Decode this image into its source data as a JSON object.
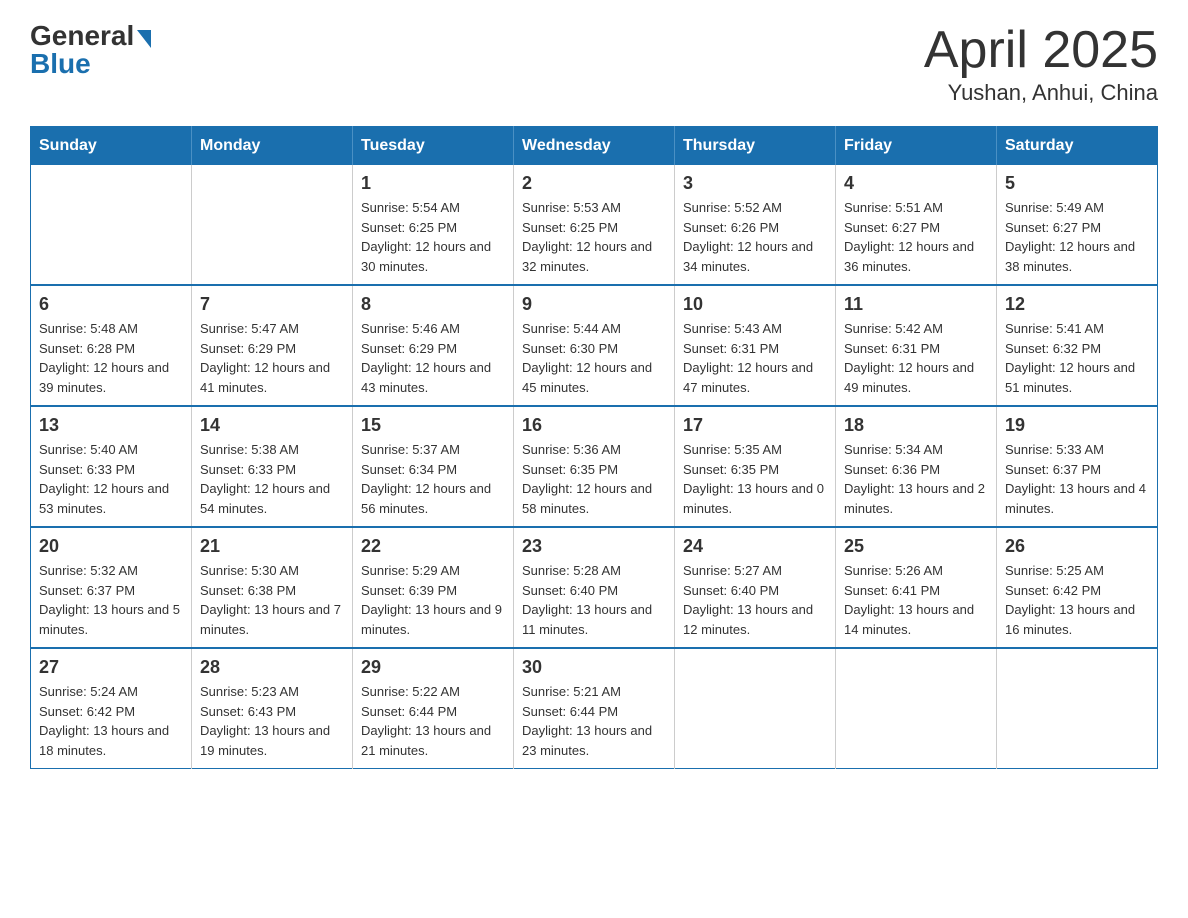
{
  "header": {
    "logo_general": "General",
    "logo_blue": "Blue",
    "title": "April 2025",
    "subtitle": "Yushan, Anhui, China"
  },
  "calendar": {
    "weekdays": [
      "Sunday",
      "Monday",
      "Tuesday",
      "Wednesday",
      "Thursday",
      "Friday",
      "Saturday"
    ],
    "weeks": [
      [
        {
          "day": "",
          "sunrise": "",
          "sunset": "",
          "daylight": ""
        },
        {
          "day": "",
          "sunrise": "",
          "sunset": "",
          "daylight": ""
        },
        {
          "day": "1",
          "sunrise": "Sunrise: 5:54 AM",
          "sunset": "Sunset: 6:25 PM",
          "daylight": "Daylight: 12 hours and 30 minutes."
        },
        {
          "day": "2",
          "sunrise": "Sunrise: 5:53 AM",
          "sunset": "Sunset: 6:25 PM",
          "daylight": "Daylight: 12 hours and 32 minutes."
        },
        {
          "day": "3",
          "sunrise": "Sunrise: 5:52 AM",
          "sunset": "Sunset: 6:26 PM",
          "daylight": "Daylight: 12 hours and 34 minutes."
        },
        {
          "day": "4",
          "sunrise": "Sunrise: 5:51 AM",
          "sunset": "Sunset: 6:27 PM",
          "daylight": "Daylight: 12 hours and 36 minutes."
        },
        {
          "day": "5",
          "sunrise": "Sunrise: 5:49 AM",
          "sunset": "Sunset: 6:27 PM",
          "daylight": "Daylight: 12 hours and 38 minutes."
        }
      ],
      [
        {
          "day": "6",
          "sunrise": "Sunrise: 5:48 AM",
          "sunset": "Sunset: 6:28 PM",
          "daylight": "Daylight: 12 hours and 39 minutes."
        },
        {
          "day": "7",
          "sunrise": "Sunrise: 5:47 AM",
          "sunset": "Sunset: 6:29 PM",
          "daylight": "Daylight: 12 hours and 41 minutes."
        },
        {
          "day": "8",
          "sunrise": "Sunrise: 5:46 AM",
          "sunset": "Sunset: 6:29 PM",
          "daylight": "Daylight: 12 hours and 43 minutes."
        },
        {
          "day": "9",
          "sunrise": "Sunrise: 5:44 AM",
          "sunset": "Sunset: 6:30 PM",
          "daylight": "Daylight: 12 hours and 45 minutes."
        },
        {
          "day": "10",
          "sunrise": "Sunrise: 5:43 AM",
          "sunset": "Sunset: 6:31 PM",
          "daylight": "Daylight: 12 hours and 47 minutes."
        },
        {
          "day": "11",
          "sunrise": "Sunrise: 5:42 AM",
          "sunset": "Sunset: 6:31 PM",
          "daylight": "Daylight: 12 hours and 49 minutes."
        },
        {
          "day": "12",
          "sunrise": "Sunrise: 5:41 AM",
          "sunset": "Sunset: 6:32 PM",
          "daylight": "Daylight: 12 hours and 51 minutes."
        }
      ],
      [
        {
          "day": "13",
          "sunrise": "Sunrise: 5:40 AM",
          "sunset": "Sunset: 6:33 PM",
          "daylight": "Daylight: 12 hours and 53 minutes."
        },
        {
          "day": "14",
          "sunrise": "Sunrise: 5:38 AM",
          "sunset": "Sunset: 6:33 PM",
          "daylight": "Daylight: 12 hours and 54 minutes."
        },
        {
          "day": "15",
          "sunrise": "Sunrise: 5:37 AM",
          "sunset": "Sunset: 6:34 PM",
          "daylight": "Daylight: 12 hours and 56 minutes."
        },
        {
          "day": "16",
          "sunrise": "Sunrise: 5:36 AM",
          "sunset": "Sunset: 6:35 PM",
          "daylight": "Daylight: 12 hours and 58 minutes."
        },
        {
          "day": "17",
          "sunrise": "Sunrise: 5:35 AM",
          "sunset": "Sunset: 6:35 PM",
          "daylight": "Daylight: 13 hours and 0 minutes."
        },
        {
          "day": "18",
          "sunrise": "Sunrise: 5:34 AM",
          "sunset": "Sunset: 6:36 PM",
          "daylight": "Daylight: 13 hours and 2 minutes."
        },
        {
          "day": "19",
          "sunrise": "Sunrise: 5:33 AM",
          "sunset": "Sunset: 6:37 PM",
          "daylight": "Daylight: 13 hours and 4 minutes."
        }
      ],
      [
        {
          "day": "20",
          "sunrise": "Sunrise: 5:32 AM",
          "sunset": "Sunset: 6:37 PM",
          "daylight": "Daylight: 13 hours and 5 minutes."
        },
        {
          "day": "21",
          "sunrise": "Sunrise: 5:30 AM",
          "sunset": "Sunset: 6:38 PM",
          "daylight": "Daylight: 13 hours and 7 minutes."
        },
        {
          "day": "22",
          "sunrise": "Sunrise: 5:29 AM",
          "sunset": "Sunset: 6:39 PM",
          "daylight": "Daylight: 13 hours and 9 minutes."
        },
        {
          "day": "23",
          "sunrise": "Sunrise: 5:28 AM",
          "sunset": "Sunset: 6:40 PM",
          "daylight": "Daylight: 13 hours and 11 minutes."
        },
        {
          "day": "24",
          "sunrise": "Sunrise: 5:27 AM",
          "sunset": "Sunset: 6:40 PM",
          "daylight": "Daylight: 13 hours and 12 minutes."
        },
        {
          "day": "25",
          "sunrise": "Sunrise: 5:26 AM",
          "sunset": "Sunset: 6:41 PM",
          "daylight": "Daylight: 13 hours and 14 minutes."
        },
        {
          "day": "26",
          "sunrise": "Sunrise: 5:25 AM",
          "sunset": "Sunset: 6:42 PM",
          "daylight": "Daylight: 13 hours and 16 minutes."
        }
      ],
      [
        {
          "day": "27",
          "sunrise": "Sunrise: 5:24 AM",
          "sunset": "Sunset: 6:42 PM",
          "daylight": "Daylight: 13 hours and 18 minutes."
        },
        {
          "day": "28",
          "sunrise": "Sunrise: 5:23 AM",
          "sunset": "Sunset: 6:43 PM",
          "daylight": "Daylight: 13 hours and 19 minutes."
        },
        {
          "day": "29",
          "sunrise": "Sunrise: 5:22 AM",
          "sunset": "Sunset: 6:44 PM",
          "daylight": "Daylight: 13 hours and 21 minutes."
        },
        {
          "day": "30",
          "sunrise": "Sunrise: 5:21 AM",
          "sunset": "Sunset: 6:44 PM",
          "daylight": "Daylight: 13 hours and 23 minutes."
        },
        {
          "day": "",
          "sunrise": "",
          "sunset": "",
          "daylight": ""
        },
        {
          "day": "",
          "sunrise": "",
          "sunset": "",
          "daylight": ""
        },
        {
          "day": "",
          "sunrise": "",
          "sunset": "",
          "daylight": ""
        }
      ]
    ]
  }
}
